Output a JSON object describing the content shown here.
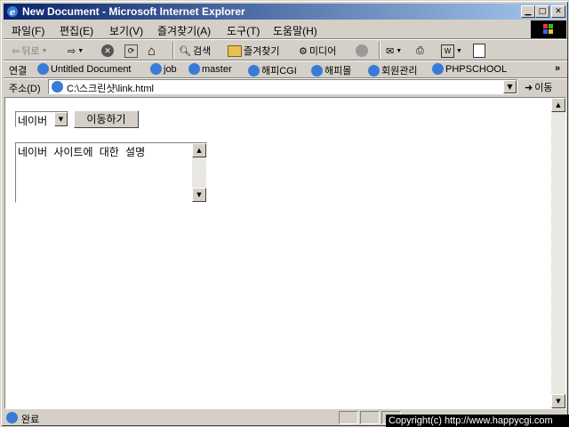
{
  "window": {
    "title": "New Document - Microsoft Internet Explorer"
  },
  "menu": [
    "파일(F)",
    "편집(E)",
    "보기(V)",
    "즐겨찾기(A)",
    "도구(T)",
    "도움말(H)"
  ],
  "toolbar": {
    "back": "뒤로",
    "search": "검색",
    "favorites": "즐겨찾기",
    "media": "미디어"
  },
  "links": {
    "label": "연결",
    "items": [
      "Untitled Document",
      "job",
      "master",
      "해피CGI",
      "해피몰",
      "회원관리",
      "PHPSCHOOL"
    ],
    "more": "»"
  },
  "address": {
    "label": "주소(D)",
    "value": "C:\\스크린샷\\link.html",
    "go": "이동"
  },
  "page": {
    "select_value": "네이버",
    "go_button": "이동하기",
    "description": "네이버 사이트에 대한 설명"
  },
  "status": {
    "text": "완료"
  },
  "watermark": {
    "text": "Copyright(c) http://www.happycgi.com"
  },
  "colors": {
    "titlebar_start": "#0a246a",
    "titlebar_end": "#a6caf0",
    "chrome": "#d4d0c8"
  }
}
